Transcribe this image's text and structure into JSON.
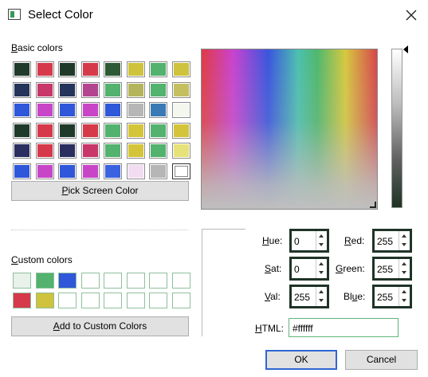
{
  "window": {
    "title": "Select Color",
    "icon": "color-dialog-icon",
    "close_icon": "close-icon"
  },
  "basic_colors": {
    "label_prefix": "",
    "label_underlined": "B",
    "label_rest": "asic colors",
    "swatches": [
      [
        "#1f3a2a",
        "#d6394a",
        "#1f3a2a",
        "#d6394a",
        "#2c5a34",
        "#cfc23c",
        "#52b26e",
        "#cfc23c"
      ],
      [
        "#24345a",
        "#c8366a",
        "#24345a",
        "#b3458f",
        "#52b26e",
        "#b4b45c",
        "#52b26e",
        "#c4c060"
      ],
      [
        "#2f57d9",
        "#c845c8",
        "#2f57d9",
        "#c845c8",
        "#2f57d9",
        "#b6b6b6",
        "#3a7ab5",
        "#f4f7ee"
      ],
      [
        "#1f3a2a",
        "#d6394a",
        "#1f3a2a",
        "#d6394a",
        "#52b26e",
        "#d4c43a",
        "#52b26e",
        "#d4c43a"
      ],
      [
        "#2a2f60",
        "#d6394a",
        "#2a2f60",
        "#c8366a",
        "#52b26e",
        "#d4c43a",
        "#52b26e",
        "#e6e27a"
      ],
      [
        "#2f57d9",
        "#c845c8",
        "#2f57d9",
        "#c845c8",
        "#3b62e0",
        "#f1dcf1",
        "#b6b6b6",
        "#ffffff"
      ]
    ]
  },
  "pick_screen_button": {
    "underlined": "P",
    "rest": "ick Screen Color"
  },
  "custom_colors": {
    "label_underlined": "C",
    "label_rest": "ustom colors",
    "swatches": [
      [
        "#e8f1ea",
        "#52b26e",
        "#2f57d9",
        "#ffffff",
        "#ffffff",
        "#ffffff",
        "#ffffff",
        "#ffffff"
      ],
      [
        "#d6394a",
        "#cfc23c",
        "#ffffff",
        "#ffffff",
        "#ffffff",
        "#ffffff",
        "#ffffff",
        "#ffffff"
      ]
    ]
  },
  "add_custom_button": {
    "underlined": "A",
    "rest": "dd to Custom Colors"
  },
  "fields": {
    "hue": {
      "label_u": "H",
      "label_rest": "ue:",
      "value": "0"
    },
    "sat": {
      "label_u": "S",
      "label_rest": "at:",
      "value": "0"
    },
    "val": {
      "label_u": "V",
      "label_rest": "al:",
      "value": "255"
    },
    "red": {
      "label_u": "R",
      "label_rest": "ed:",
      "value": "255"
    },
    "green": {
      "label_u": "G",
      "label_rest": "reen:",
      "value": "255"
    },
    "blue": {
      "label_pre": "Bl",
      "label_u": "u",
      "label_rest": "e:",
      "value": "255"
    },
    "html": {
      "label_u": "H",
      "label_rest": "TML:",
      "value": "#ffffff"
    }
  },
  "buttons": {
    "ok": "OK",
    "cancel": "Cancel"
  }
}
